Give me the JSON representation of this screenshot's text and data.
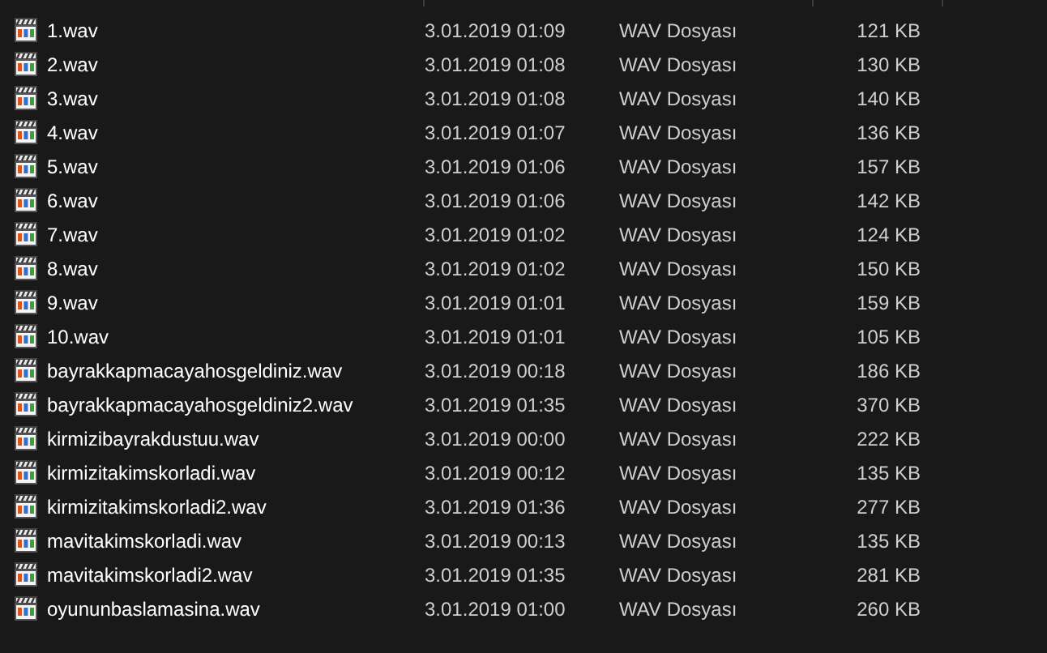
{
  "files": [
    {
      "name": "1.wav",
      "date": "3.01.2019 01:09",
      "type": "WAV Dosyası",
      "size": "121 KB"
    },
    {
      "name": "2.wav",
      "date": "3.01.2019 01:08",
      "type": "WAV Dosyası",
      "size": "130 KB"
    },
    {
      "name": "3.wav",
      "date": "3.01.2019 01:08",
      "type": "WAV Dosyası",
      "size": "140 KB"
    },
    {
      "name": "4.wav",
      "date": "3.01.2019 01:07",
      "type": "WAV Dosyası",
      "size": "136 KB"
    },
    {
      "name": "5.wav",
      "date": "3.01.2019 01:06",
      "type": "WAV Dosyası",
      "size": "157 KB"
    },
    {
      "name": "6.wav",
      "date": "3.01.2019 01:06",
      "type": "WAV Dosyası",
      "size": "142 KB"
    },
    {
      "name": "7.wav",
      "date": "3.01.2019 01:02",
      "type": "WAV Dosyası",
      "size": "124 KB"
    },
    {
      "name": "8.wav",
      "date": "3.01.2019 01:02",
      "type": "WAV Dosyası",
      "size": "150 KB"
    },
    {
      "name": "9.wav",
      "date": "3.01.2019 01:01",
      "type": "WAV Dosyası",
      "size": "159 KB"
    },
    {
      "name": "10.wav",
      "date": "3.01.2019 01:01",
      "type": "WAV Dosyası",
      "size": "105 KB"
    },
    {
      "name": "bayrakkapmacayahosgeldiniz.wav",
      "date": "3.01.2019 00:18",
      "type": "WAV Dosyası",
      "size": "186 KB"
    },
    {
      "name": "bayrakkapmacayahosgeldiniz2.wav",
      "date": "3.01.2019 01:35",
      "type": "WAV Dosyası",
      "size": "370 KB"
    },
    {
      "name": "kirmizibayrakdustuu.wav",
      "date": "3.01.2019 00:00",
      "type": "WAV Dosyası",
      "size": "222 KB"
    },
    {
      "name": "kirmizitakimskorladi.wav",
      "date": "3.01.2019 00:12",
      "type": "WAV Dosyası",
      "size": "135 KB"
    },
    {
      "name": "kirmizitakimskorladi2.wav",
      "date": "3.01.2019 01:36",
      "type": "WAV Dosyası",
      "size": "277 KB"
    },
    {
      "name": "mavitakimskorladi.wav",
      "date": "3.01.2019 00:13",
      "type": "WAV Dosyası",
      "size": "135 KB"
    },
    {
      "name": "mavitakimskorladi2.wav",
      "date": "3.01.2019 01:35",
      "type": "WAV Dosyası",
      "size": "281 KB"
    },
    {
      "name": "oyununbaslamasina.wav",
      "date": "3.01.2019 01:00",
      "type": "WAV Dosyası",
      "size": "260 KB"
    }
  ]
}
